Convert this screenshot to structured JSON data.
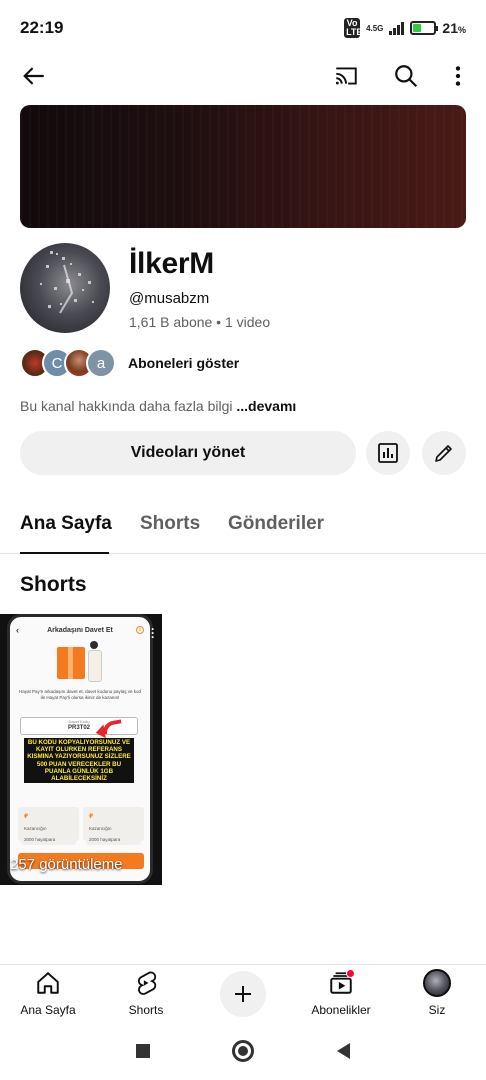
{
  "status_bar": {
    "time": "22:19",
    "volte": "Vo LTE",
    "network": "4.5G",
    "battery_percent": "21",
    "battery_unit": "%",
    "battery_level": 0.21
  },
  "channel": {
    "name": "İlkerM",
    "handle": "@musabzm",
    "stats": "1,61 B abone • 1 video",
    "subscribers_label": "Aboneleri göster",
    "subscriber_initials": [
      "C",
      "a"
    ],
    "about_text": "Bu kanal hakkında daha fazla bilgi",
    "about_more": "...devamı"
  },
  "actions": {
    "manage_videos": "Videoları yönet"
  },
  "tabs": [
    {
      "label": "Ana Sayfa",
      "active": true
    },
    {
      "label": "Shorts",
      "active": false
    },
    {
      "label": "Gönderiler",
      "active": false
    }
  ],
  "section": {
    "title": "Shorts"
  },
  "short_card": {
    "views": "257 görüntüleme",
    "screen_title": "Arkadaşını Davet Et",
    "screen_desc": "Hayat Pay'e arkadaşını davet et, davet kodunu paylaş ve kod ile Hayat Pay'li olursa ikiniz de kazanın!",
    "code_label": "Davet Kodu",
    "code_value": "PR3T02",
    "overlay": "BU KODU KOPYALIYORSUNUZ VE KAYIT OLURKEN REFERANS KISMINA YAZIYORSUNUZ SİZLERE 500 PUAN VERECEKLER BU PUANLA GÜNLÜK 1GB ALABİLECEKSİNİZ",
    "points_left_value": "3000 hayatpara",
    "points_right_value": "2000 hayatpara",
    "points_left_label": "Kazancığın",
    "points_right_label": "Kazancığın"
  },
  "bottom_nav": [
    {
      "label": "Ana Sayfa",
      "icon": "home-icon"
    },
    {
      "label": "Shorts",
      "icon": "shorts-icon"
    },
    {
      "label": "",
      "icon": "plus-icon"
    },
    {
      "label": "Abonelikler",
      "icon": "subscriptions-icon"
    },
    {
      "label": "Siz",
      "icon": "avatar"
    }
  ],
  "colors": {
    "accent_red": "#ff0033",
    "chip_bg": "#f0f0f0",
    "secondary_text": "#606060"
  }
}
